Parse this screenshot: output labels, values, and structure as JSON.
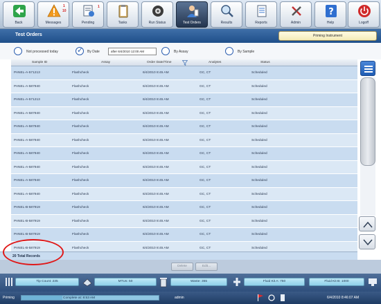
{
  "toolbar": {
    "buttons": [
      {
        "label": "Back",
        "icon": "back-arrow-icon"
      },
      {
        "label": "Messages",
        "icon": "warning-icon",
        "badge_top": "1",
        "badge_bottom": "10"
      },
      {
        "label": "Pending",
        "icon": "pending-icon",
        "badge_top": "1"
      },
      {
        "label": "Tasks",
        "icon": "clipboard-icon"
      },
      {
        "label": "Run Status",
        "icon": "run-status-icon"
      },
      {
        "label": "Test Orders",
        "icon": "test-orders-icon",
        "active": true
      },
      {
        "label": "Results",
        "icon": "magnifier-icon"
      },
      {
        "label": "Reports",
        "icon": "report-icon"
      },
      {
        "label": "Admin",
        "icon": "admin-tools-icon"
      },
      {
        "label": "Help",
        "icon": "help-icon"
      },
      {
        "label": "Logoff",
        "icon": "power-icon"
      }
    ]
  },
  "header": {
    "title": "Test Orders",
    "status_banner": "Priming Instrument"
  },
  "filters": {
    "options": [
      "Not processed today",
      "By Date",
      "By Assay",
      "By Sample"
    ],
    "selected": "By Date",
    "date_value": "after 6/4/2010 12:00 AM"
  },
  "table": {
    "columns": [
      "Sample ID",
      "Assay",
      "Order Date/Time",
      "Analytes",
      "Status"
    ],
    "rows": [
      [
        "PANEL-A-571213",
        "Flashcheck",
        "6/4/2010 8:45 AM",
        "GC, CT",
        "Scheduled"
      ],
      [
        "PANEL-A-587940",
        "Flashcheck",
        "6/4/2010 8:45 AM",
        "GC, CT",
        "Scheduled"
      ],
      [
        "PANEL-A-571213",
        "Flashcheck",
        "6/4/2010 8:45 AM",
        "GC, CT",
        "Scheduled"
      ],
      [
        "PANEL-A-587940",
        "Flashcheck",
        "6/4/2010 8:45 AM",
        "GC, CT",
        "Scheduled"
      ],
      [
        "PANEL-A-587940",
        "Flashcheck",
        "6/4/2010 8:45 AM",
        "GC, CT",
        "Scheduled"
      ],
      [
        "PANEL-A-587940",
        "Flashcheck",
        "6/4/2010 8:45 AM",
        "GC, CT",
        "Scheduled"
      ],
      [
        "PANEL-A-587940",
        "Flashcheck",
        "6/4/2010 8:45 AM",
        "GC, CT",
        "Scheduled"
      ],
      [
        "PANEL-A-587940",
        "Flashcheck",
        "6/4/2010 8:45 AM",
        "GC, CT",
        "Scheduled"
      ],
      [
        "PANEL-A-587940",
        "Flashcheck",
        "6/4/2010 8:45 AM",
        "GC, CT",
        "Scheduled"
      ],
      [
        "PANEL-A-587940",
        "Flashcheck",
        "6/4/2010 8:45 AM",
        "GC, CT",
        "Scheduled"
      ],
      [
        "PANEL-B-587919",
        "Flashcheck",
        "6/4/2010 8:45 AM",
        "GC, CT",
        "Scheduled"
      ],
      [
        "PANEL-B-587919",
        "Flashcheck",
        "6/4/2010 8:45 AM",
        "GC, CT",
        "Scheduled"
      ],
      [
        "PANEL-B-587919",
        "Flashcheck",
        "6/4/2010 8:45 AM",
        "GC, CT",
        "Scheduled"
      ],
      [
        "PANEL-B-587919",
        "Flashcheck",
        "6/4/2010 8:45 AM",
        "GC, CT",
        "Scheduled"
      ]
    ],
    "total_records": "20 Total Records"
  },
  "actions": {
    "delete_label": "Delete",
    "edit_label": "Edit..."
  },
  "consumables": {
    "tip_count": "Tip Count: 235",
    "mtus": "MTUs: 50",
    "waste": "Waste: 355",
    "fluid_kit_a": "Fluid Kit A: 750",
    "fluid_kit_b": "Fluid Kit B: 1000"
  },
  "statusbar": {
    "state": "Priming",
    "progress_text": "Complete at: 8:53 AM",
    "progress_fraction": 0.3,
    "user": "admin",
    "datetime": "6/4/2010 8:46:07 AM"
  },
  "colors": {
    "title_bar": "#1f4f8a",
    "row_even": "#c9dcf0",
    "row_odd": "#dbe8f5",
    "annotation": "#e01818",
    "consumable": "#8fd0ea"
  }
}
